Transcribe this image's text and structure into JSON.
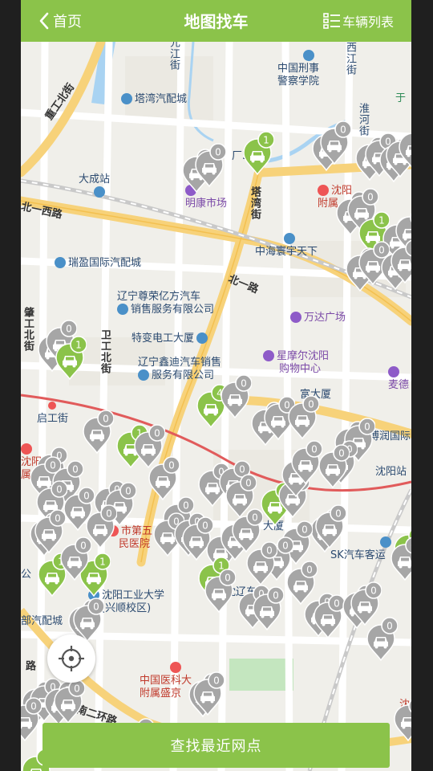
{
  "header": {
    "back_label": "首页",
    "title": "地图找车",
    "list_label": "车辆列表"
  },
  "map": {
    "labels": {
      "yuanjiang": "元江街",
      "xixing": "西江街",
      "huaihe": "淮河街",
      "yu": "于",
      "xingshi": "中国刑事",
      "xingshi2": "警察学院",
      "tawan_auto": "塔湾汽配城",
      "zhonggongbei": "重工北街",
      "dacheng": "大成站",
      "chang5": "厂5区",
      "mingkang": "明康市场",
      "tawanjie": "塔湾街",
      "shenyang_fu": "沈阳",
      "shenyang_fu2": "附属",
      "beiyixi": "北一西路",
      "zhonghai": "中海寰宇天下",
      "ruiying": "瑞盈国际汽配城",
      "zunrong": "辽宁尊荣亿方汽车",
      "zunrong2": "销售服务有限公司",
      "beiyi": "北一路",
      "wanda": "万达广场",
      "tebian": "特变电工大厦",
      "weigong": "卫工北街",
      "yugong": "肇工北街",
      "xindi": "辽宁鑫迪汽车销售",
      "xindi2": "服务有限公司",
      "xingmoer": "星摩尔沈阳",
      "xingmoer2": "购物中心",
      "maide": "麦德",
      "qigong": "启工街",
      "shi_yi": "沈阳",
      "shi_yi2": "属中",
      "fuda": "富大厦",
      "borun": "博润国际",
      "shenyangzhan": "沈阳站",
      "shiwuyuan": "市第五",
      "shiwuyuan2": "民医院",
      "sk": "SK汽车客运",
      "gongye": "沈阳工业大学",
      "gongye2": "(兴顺校区)",
      "liaodong": "沈辽东",
      "xiasha": "大厦",
      "gong": "公",
      "bu_qipei": "部汽配城",
      "yike": "中国医科大",
      "yike2": "附属盛京",
      "nanerhuan": "南二环路",
      "lu": "路",
      "shen_e": "沈"
    },
    "pins": [
      {
        "count": "1",
        "active": true
      },
      {
        "count": "0",
        "active": false
      }
    ]
  },
  "buttons": {
    "locate_icon": "crosshair-locate-icon",
    "find_nearest": "查找最近网点"
  },
  "colors": {
    "brand_green": "#8bc34a",
    "pin_grey": "#a6a6a6",
    "road_yellow": "#f7d27a",
    "water": "#a9d3f2",
    "park": "#c4e6bf"
  }
}
